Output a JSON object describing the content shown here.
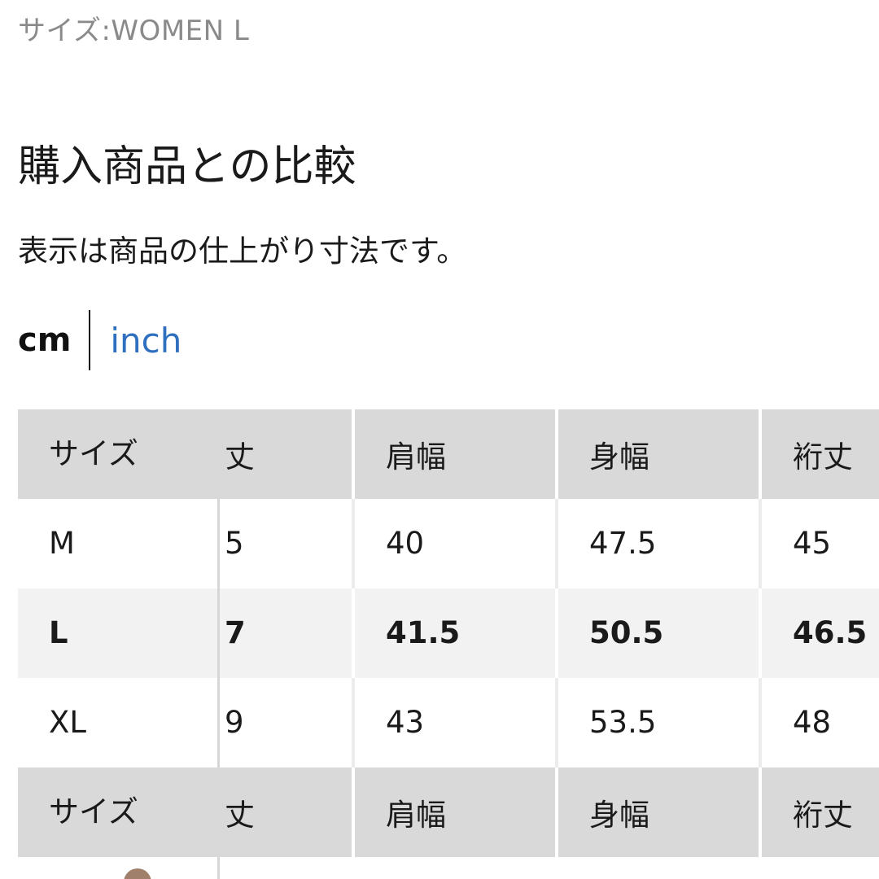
{
  "size_line": "サイズ:WOMEN L",
  "section_title": "購入商品との比較",
  "note": "表示は商品の仕上がり寸法です。",
  "units": {
    "cm": "cm",
    "inch": "inch"
  },
  "table": {
    "headers": [
      "サイズ",
      "丈",
      "肩幅",
      "身幅",
      "裄丈"
    ],
    "rows": [
      [
        "M",
        "5",
        "40",
        "47.5",
        "45"
      ],
      [
        "L",
        "7",
        "41.5",
        "50.5",
        "46.5"
      ],
      [
        "XL",
        "9",
        "43",
        "53.5",
        "48"
      ]
    ]
  },
  "colors": {
    "link": "#2f6fbf",
    "header_bg": "#d9d9d9",
    "highlight_row_bg": "#f2f2f2",
    "muted_text": "#8a8a8a"
  }
}
